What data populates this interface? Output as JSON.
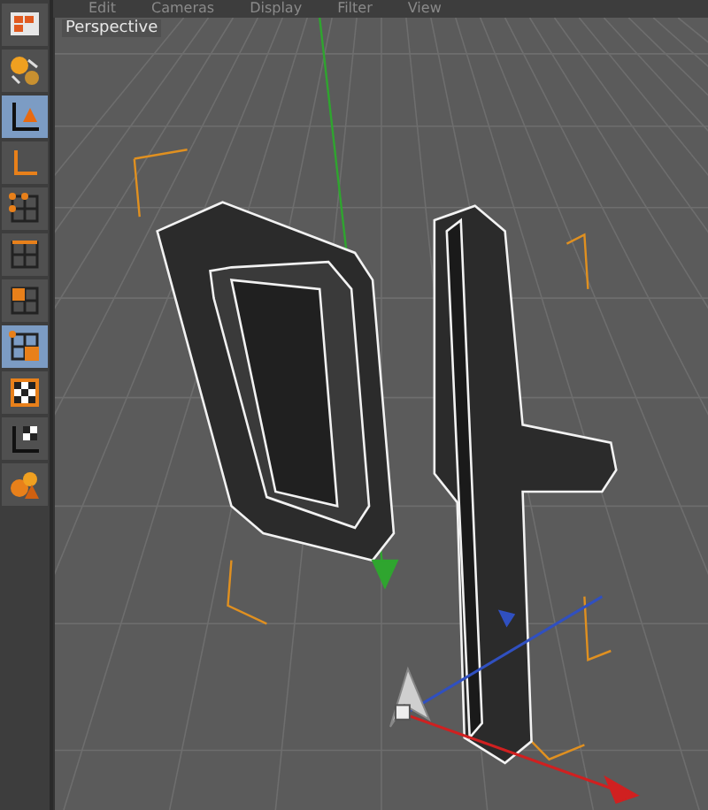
{
  "menu_bar": {
    "items": [
      "Edit",
      "Cameras",
      "Display",
      "Filter",
      "View"
    ]
  },
  "toolbar": {
    "tools": [
      {
        "kind": "layout",
        "selected": false
      },
      {
        "kind": "spheres",
        "selected": false
      },
      {
        "kind": "model",
        "selected": true
      },
      {
        "kind": "axis",
        "selected": false
      },
      {
        "kind": "points",
        "selected": false
      },
      {
        "kind": "edges",
        "selected": false
      },
      {
        "kind": "polygons",
        "selected": false
      },
      {
        "kind": "uv",
        "selected": true
      },
      {
        "kind": "texture",
        "selected": false
      },
      {
        "kind": "texture-axis",
        "selected": false
      },
      {
        "kind": "shapes",
        "selected": false
      }
    ]
  },
  "viewport": {
    "label": "Perspective"
  }
}
